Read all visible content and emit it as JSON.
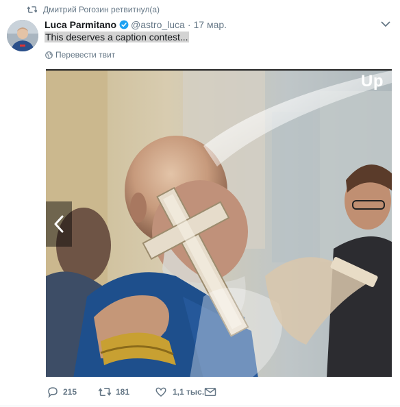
{
  "retweet": {
    "text": "Дмитрий Рогозин ретвитнул(а)",
    "icon": "retweet-icon"
  },
  "author": {
    "name": "Luca Parmitano",
    "handle": "@astro_luca",
    "separator": "·",
    "date": "17 мар.",
    "verified": true
  },
  "tweet": {
    "text": "This deserves a caption contest..."
  },
  "translate": {
    "label": "Перевести твит"
  },
  "media": {
    "watermark": "Up"
  },
  "actions": {
    "replies": "215",
    "retweets": "181",
    "likes": "1,1 тыс."
  },
  "colors": {
    "secondary_text": "#657786",
    "verified": "#1da1f2",
    "primary_text": "#14171a"
  }
}
